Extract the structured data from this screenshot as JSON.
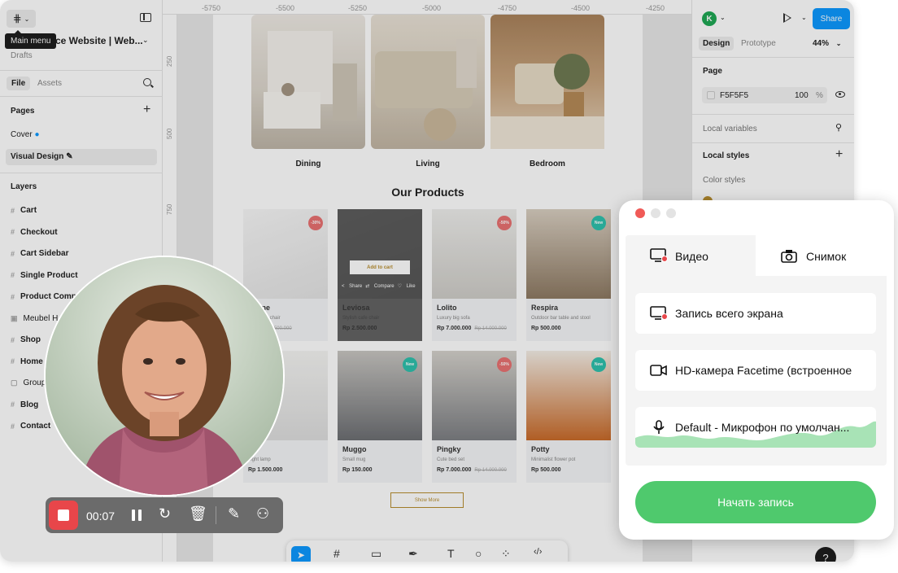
{
  "file": {
    "title": "ce Website | Web...",
    "location": "Drafts",
    "tooltip": "Main menu"
  },
  "left_tabs": {
    "file": "File",
    "assets": "Assets"
  },
  "pages": {
    "header": "Pages",
    "items": [
      {
        "label": "Cover"
      },
      {
        "label": "Visual Design"
      }
    ]
  },
  "layers": {
    "header": "Layers",
    "items": [
      "Cart",
      "Checkout",
      "Cart Sidebar",
      "Single Product",
      "Product Comp",
      "Meubel H",
      "Shop",
      "Home",
      "Group",
      "Blog",
      "Contact"
    ]
  },
  "ruler": {
    "top": [
      "-5750",
      "-5500",
      "-5250",
      "-5000",
      "-4750",
      "-4500",
      "-4250"
    ],
    "left": [
      "250",
      "500",
      "750"
    ]
  },
  "design": {
    "categories": [
      "Dining",
      "Living",
      "Bedroom"
    ],
    "section_title": "Our Products",
    "products": [
      {
        "name": "herine",
        "desc": "ylish cafe chair",
        "price": ".000",
        "old": "Rp 3.500.000",
        "badge": "-30%",
        "badge_color": "#e97171"
      },
      {
        "name": "Leviosa",
        "desc": "Stylish cafe chair",
        "price": "Rp 2.500.000",
        "old": "",
        "badge": "",
        "badge_color": ""
      },
      {
        "name": "Lolito",
        "desc": "Luxury big sofa",
        "price": "Rp 7.000.000",
        "old": "Rp 14.000.000",
        "badge": "-50%",
        "badge_color": "#e97171"
      },
      {
        "name": "Respira",
        "desc": "Outdoor bar table and stool",
        "price": "Rp 500.000",
        "old": "",
        "badge": "New",
        "badge_color": "#2ec1ac"
      },
      {
        "name": "fo",
        "desc": "night lamp",
        "price": "Rp 1.500.000",
        "old": "",
        "badge": "",
        "badge_color": ""
      },
      {
        "name": "Muggo",
        "desc": "Small mug",
        "price": "Rp 150.000",
        "old": "",
        "badge": "New",
        "badge_color": "#2ec1ac"
      },
      {
        "name": "Pingky",
        "desc": "Cute bed set",
        "price": "Rp 7.000.000",
        "old": "Rp 14.000.000",
        "badge": "-50%",
        "badge_color": "#e97171"
      },
      {
        "name": "Potty",
        "desc": "Minimalist flower pot",
        "price": "Rp 500.000",
        "old": "",
        "badge": "New",
        "badge_color": "#2ec1ac"
      }
    ],
    "hover": {
      "add_to_cart": "Add to cart",
      "share": "< Share",
      "compare": "⇄ Compare",
      "like": "♡ Like"
    },
    "show_more": "Show More"
  },
  "right": {
    "avatar_letter": "K",
    "share": "Share",
    "tabs": {
      "design": "Design",
      "prototype": "Prototype"
    },
    "zoom": "44%",
    "page_header": "Page",
    "bg_hex": "F5F5F5",
    "bg_opacity": "100",
    "bg_opacity_unit": "%",
    "local_variables": "Local variables",
    "local_styles": "Local styles",
    "color_styles": "Color styles"
  },
  "recorder": {
    "time": "00:07",
    "tabs": {
      "video": "Видео",
      "snapshot": "Снимок"
    },
    "options": [
      "Запись всего экрана",
      "HD-камера Facetime (встроенное",
      "Default - Микрофон по умолчан..."
    ],
    "start_button": "Начать запись"
  },
  "colors": {
    "accent": "#0d99ff",
    "record_red": "#e8464a",
    "start_green": "#4fc96d",
    "brand_gold": "#b88e2f"
  }
}
